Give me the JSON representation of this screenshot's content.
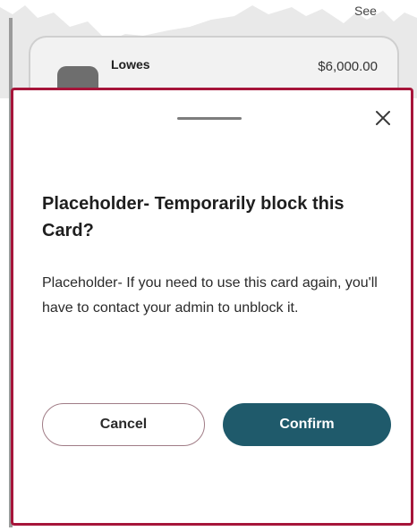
{
  "background": {
    "section_title": "",
    "see_link": "See",
    "transaction": {
      "merchant": "Lowes",
      "amount": "$6,000.00"
    }
  },
  "modal": {
    "title": "Placeholder- Temporarily block this Card?",
    "body": "Placeholder- If you need to use this card again, you'll have to contact your admin to unblock it.",
    "close_icon": "close-icon",
    "cancel_label": "Cancel",
    "confirm_label": "Confirm",
    "colors": {
      "border": "#a6153a",
      "confirm_bg": "#1f5a6b",
      "cancel_border": "#a07c86"
    }
  }
}
